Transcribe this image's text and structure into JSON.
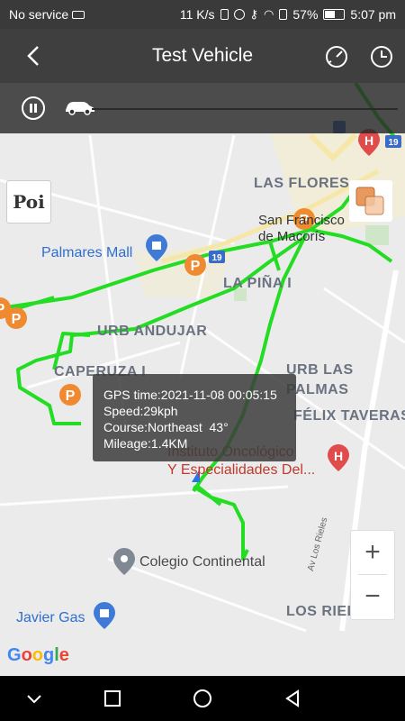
{
  "status_bar": {
    "carrier": "No service",
    "speed": "11 K/s",
    "battery": "57%",
    "time": "5:07 pm",
    "battery_level": 0.57
  },
  "header": {
    "title": "Test Vehicle",
    "back_icon": "chevron-left-icon",
    "speedometer_icon": "speedometer-icon",
    "history_icon": "clock-icon"
  },
  "playback": {
    "state": "playing",
    "pause_icon": "pause-icon",
    "vehicle_icon": "car-icon"
  },
  "map": {
    "poi_button": "Poi",
    "area_labels": {
      "las_flores": "LAS FLORES",
      "la_pina": "LA PIÑA I",
      "urb_andujar": "URB ANDUJAR",
      "caperuza": "CAPERUZA I",
      "urb_las_palmas": "URB LAS\nPALMAS",
      "felix_taveras": "FÉLIX TAVERAS",
      "los_rieles": "LOS RIEL"
    },
    "place_labels": {
      "san_francisco": "San Francisco\nde Macorís",
      "palmares": "Palmares Mall",
      "instituto": "Instituto Oncológico\nY Especialidades Del...",
      "colegio": "Colegio Continental",
      "javier_gas": "Javier Gas",
      "road_av": "Av Los Rieles"
    },
    "route_shield": "19",
    "route_color": "#22dd22",
    "parking_marker_color": "#f08a30",
    "parking_label": "P",
    "zoom_in": "+",
    "zoom_out": "−",
    "attribution": "Google"
  },
  "info_popup": {
    "gps_time": "GPS time:2021-11-08 00:05:15",
    "speed": "Speed:29kph",
    "course": "Course:Northeast  43°",
    "mileage": "Mileage:1.4KM"
  },
  "nav_bar": {
    "back": "triangle-back-icon",
    "home": "circle-home-icon",
    "recents": "square-recents-icon",
    "dropdown": "chevron-down-icon"
  }
}
